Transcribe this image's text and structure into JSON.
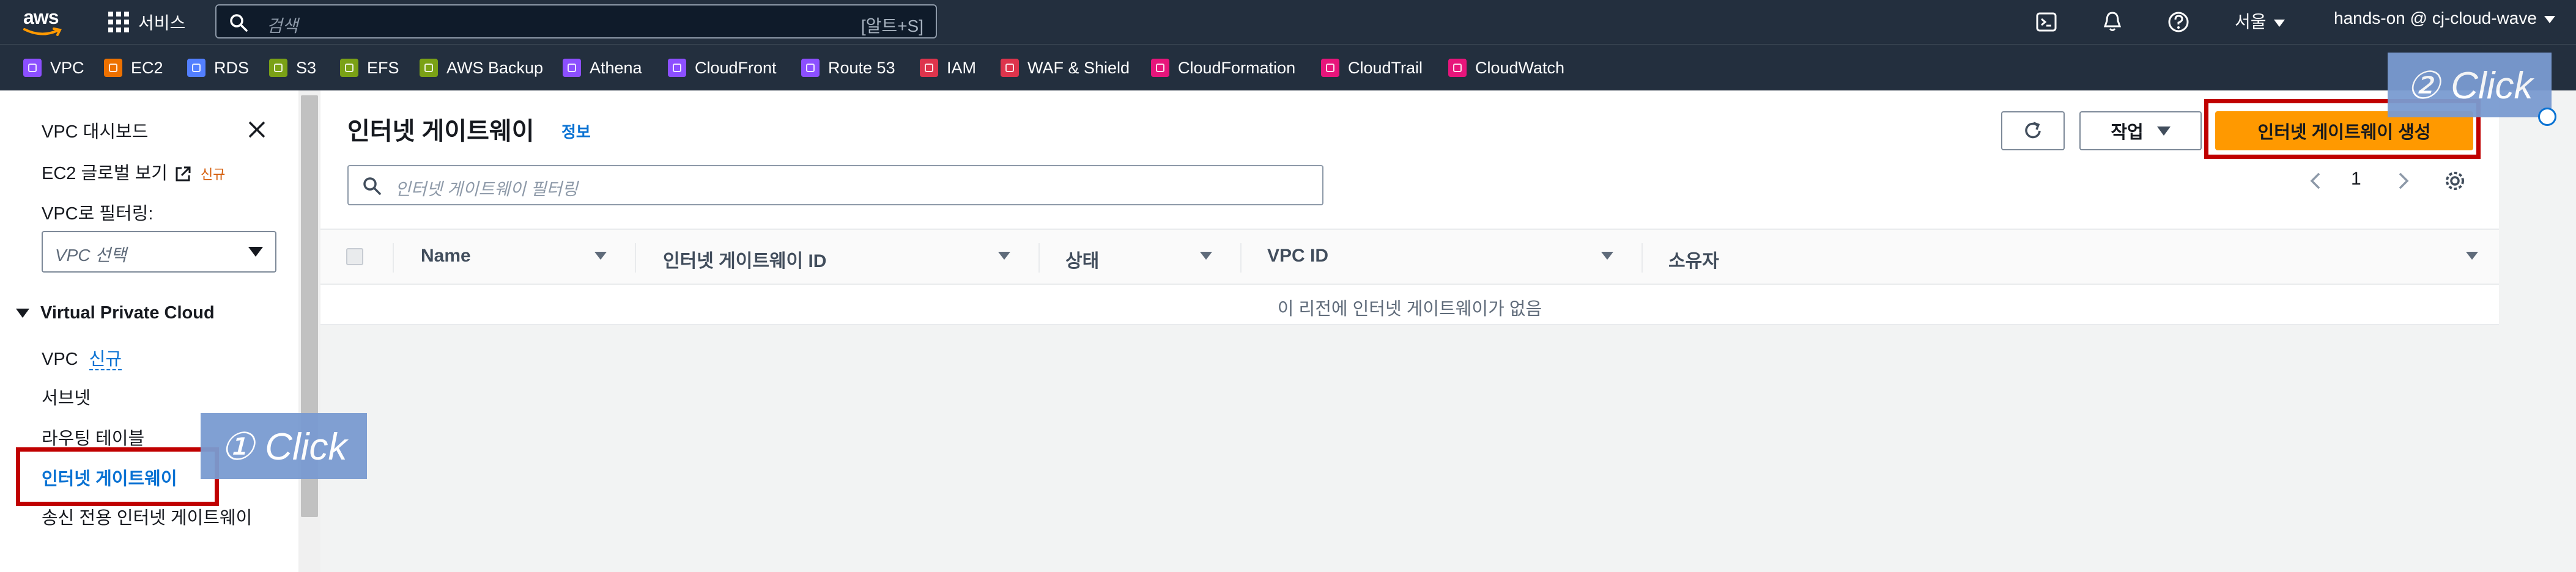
{
  "topnav": {
    "logo_text": "aws",
    "services_label": "서비스",
    "search_placeholder": "검색",
    "search_shortcut": "[알트+S]",
    "region": "서울",
    "account": "hands-on @ cj-cloud-wave",
    "icons": [
      "cloudshell-icon",
      "bell-icon",
      "help-icon"
    ]
  },
  "favorites": [
    {
      "label": "VPC",
      "color": "#8c4fff"
    },
    {
      "label": "EC2",
      "color": "#ed7100"
    },
    {
      "label": "RDS",
      "color": "#527fff"
    },
    {
      "label": "S3",
      "color": "#7aa116"
    },
    {
      "label": "EFS",
      "color": "#7aa116"
    },
    {
      "label": "AWS Backup",
      "color": "#7aa116"
    },
    {
      "label": "Athena",
      "color": "#8c4fff"
    },
    {
      "label": "CloudFront",
      "color": "#8c4fff"
    },
    {
      "label": "Route 53",
      "color": "#8c4fff"
    },
    {
      "label": "IAM",
      "color": "#dd344c"
    },
    {
      "label": "WAF & Shield",
      "color": "#dd344c"
    },
    {
      "label": "CloudFormation",
      "color": "#e7157b"
    },
    {
      "label": "CloudTrail",
      "color": "#e7157b"
    },
    {
      "label": "CloudWatch",
      "color": "#e7157b"
    }
  ],
  "sidebar": {
    "dashboard": "VPC 대시보드",
    "ec2_global": "EC2 글로벌 보기",
    "new_badge": "신규",
    "filter_label": "VPC로 필터링:",
    "filter_select": "VPC 선택",
    "section": "Virtual Private Cloud",
    "items": [
      {
        "label": "VPC",
        "extra": "신규"
      },
      {
        "label": "서브넷"
      },
      {
        "label": "라우팅 테이블"
      },
      {
        "label": "인터넷 게이트웨이"
      },
      {
        "label": "송신 전용 인터넷 게이트웨이"
      }
    ]
  },
  "main": {
    "title": "인터넷 게이트웨이",
    "info": "정보",
    "actions_label": "작업",
    "create_label": "인터넷 게이트웨이 생성",
    "filter_placeholder": "인터넷 게이트웨이 필터링",
    "page_number": "1",
    "columns": [
      "Name",
      "인터넷 게이트웨이 ID",
      "상태",
      "VPC ID",
      "소유자"
    ],
    "empty_message": "이 리전에 인터넷 게이트웨이가 없음"
  },
  "annotations": {
    "step1": "① Click",
    "step2": "② Click",
    "box_color": "#c00000",
    "callout_color": "#7a9bd1"
  },
  "colors": {
    "nav_bg": "#232f3e",
    "primary": "#ff9900",
    "link": "#0972d3"
  }
}
